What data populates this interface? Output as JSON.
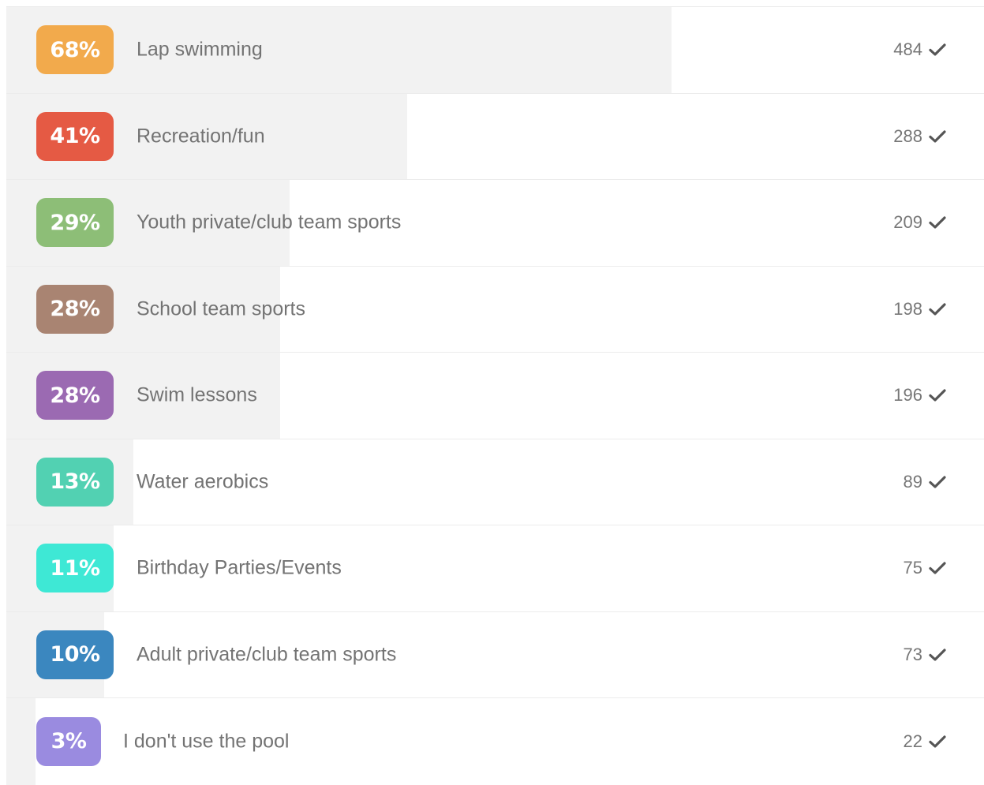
{
  "results": [
    {
      "percent": "68%",
      "label": "Lap swimming",
      "count": "484",
      "fraction": 0.68,
      "color": "#F2AA4C",
      "icon": "check-icon"
    },
    {
      "percent": "41%",
      "label": "Recreation/fun",
      "count": "288",
      "fraction": 0.41,
      "color": "#E55A44",
      "icon": "check-icon"
    },
    {
      "percent": "29%",
      "label": "Youth private/club team sports",
      "count": "209",
      "fraction": 0.29,
      "color": "#8DBE77",
      "icon": "check-icon"
    },
    {
      "percent": "28%",
      "label": "School team sports",
      "count": "198",
      "fraction": 0.28,
      "color": "#A98472",
      "icon": "check-icon"
    },
    {
      "percent": "28%",
      "label": "Swim lessons",
      "count": "196",
      "fraction": 0.28,
      "color": "#9B6AB2",
      "icon": "check-icon"
    },
    {
      "percent": "13%",
      "label": "Water aerobics",
      "count": "89",
      "fraction": 0.13,
      "color": "#52D1B2",
      "icon": "check-icon"
    },
    {
      "percent": "11%",
      "label": "Birthday Parties/Events",
      "count": "75",
      "fraction": 0.11,
      "color": "#3EE8D5",
      "icon": "check-icon"
    },
    {
      "percent": "10%",
      "label": "Adult private/club team sports",
      "count": "73",
      "fraction": 0.1,
      "color": "#3B87BF",
      "icon": "check-icon"
    },
    {
      "percent": "3%",
      "label": "I don't use the pool",
      "count": "22",
      "fraction": 0.03,
      "color": "#9A8BE0",
      "icon": "check-icon"
    }
  ]
}
